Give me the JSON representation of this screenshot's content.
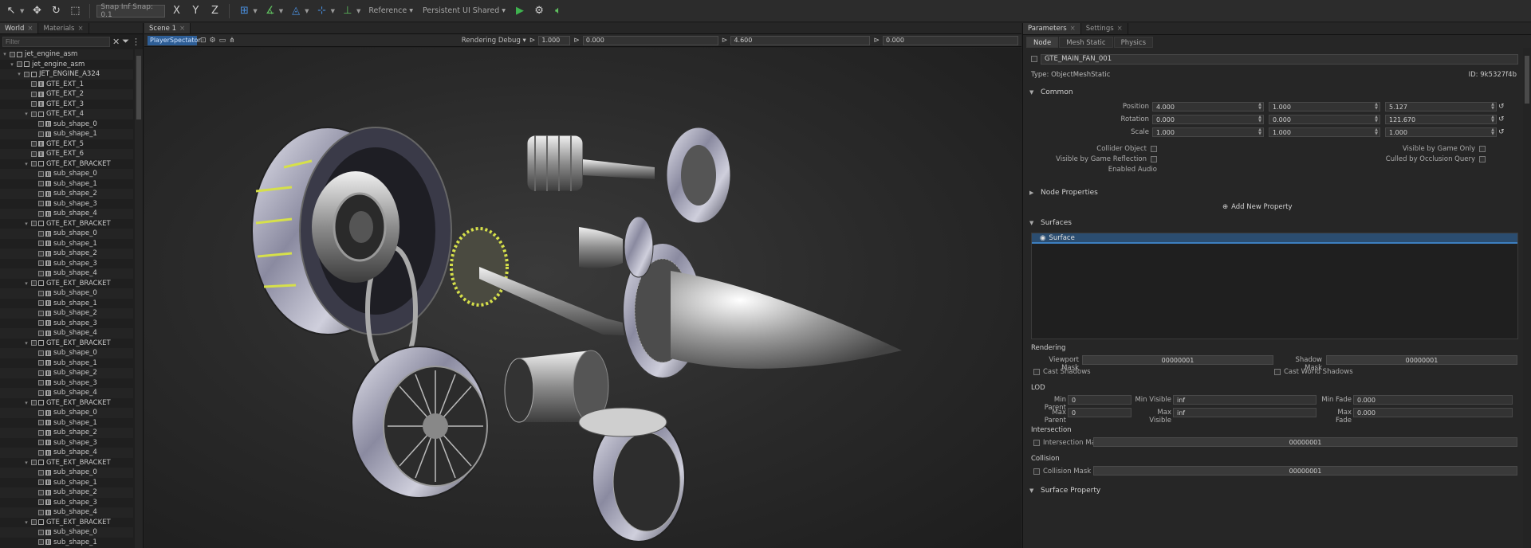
{
  "toolbar": {
    "snap_value": "Snap Inf  Snap: 0.1",
    "reference_label": "Reference ▾",
    "snapping_label": "Persistent UI Shared ▾"
  },
  "world": {
    "tabs": [
      {
        "label": "World"
      },
      {
        "label": "Materials"
      }
    ],
    "search_placeholder": "Filter",
    "tree": [
      {
        "label": "jet_engine_asm",
        "level": 0,
        "exp": "▾",
        "icon": "node"
      },
      {
        "label": "jet_engine_asm",
        "level": 1,
        "exp": "▾",
        "icon": "node"
      },
      {
        "label": "JET_ENGINE_A324",
        "level": 2,
        "exp": "▾",
        "icon": "node"
      },
      {
        "label": "GTE_EXT_1",
        "level": 3,
        "exp": "",
        "icon": "mesh"
      },
      {
        "label": "GTE_EXT_2",
        "level": 3,
        "exp": "",
        "icon": "mesh"
      },
      {
        "label": "GTE_EXT_3",
        "level": 3,
        "exp": "",
        "icon": "mesh"
      },
      {
        "label": "GTE_EXT_4",
        "level": 3,
        "exp": "▾",
        "icon": "node"
      },
      {
        "label": "sub_shape_0",
        "level": 4,
        "exp": "",
        "icon": "mesh"
      },
      {
        "label": "sub_shape_1",
        "level": 4,
        "exp": "",
        "icon": "mesh"
      },
      {
        "label": "GTE_EXT_5",
        "level": 3,
        "exp": "",
        "icon": "mesh"
      },
      {
        "label": "GTE_EXT_6",
        "level": 3,
        "exp": "",
        "icon": "mesh"
      },
      {
        "label": "GTE_EXT_BRACKET",
        "level": 3,
        "exp": "▾",
        "icon": "node"
      },
      {
        "label": "sub_shape_0",
        "level": 4,
        "exp": "",
        "icon": "mesh"
      },
      {
        "label": "sub_shape_1",
        "level": 4,
        "exp": "",
        "icon": "mesh"
      },
      {
        "label": "sub_shape_2",
        "level": 4,
        "exp": "",
        "icon": "mesh"
      },
      {
        "label": "sub_shape_3",
        "level": 4,
        "exp": "",
        "icon": "mesh"
      },
      {
        "label": "sub_shape_4",
        "level": 4,
        "exp": "",
        "icon": "mesh"
      },
      {
        "label": "GTE_EXT_BRACKET",
        "level": 3,
        "exp": "▾",
        "icon": "node"
      },
      {
        "label": "sub_shape_0",
        "level": 4,
        "exp": "",
        "icon": "mesh"
      },
      {
        "label": "sub_shape_1",
        "level": 4,
        "exp": "",
        "icon": "mesh"
      },
      {
        "label": "sub_shape_2",
        "level": 4,
        "exp": "",
        "icon": "mesh"
      },
      {
        "label": "sub_shape_3",
        "level": 4,
        "exp": "",
        "icon": "mesh"
      },
      {
        "label": "sub_shape_4",
        "level": 4,
        "exp": "",
        "icon": "mesh"
      },
      {
        "label": "GTE_EXT_BRACKET",
        "level": 3,
        "exp": "▾",
        "icon": "node"
      },
      {
        "label": "sub_shape_0",
        "level": 4,
        "exp": "",
        "icon": "mesh"
      },
      {
        "label": "sub_shape_1",
        "level": 4,
        "exp": "",
        "icon": "mesh"
      },
      {
        "label": "sub_shape_2",
        "level": 4,
        "exp": "",
        "icon": "mesh"
      },
      {
        "label": "sub_shape_3",
        "level": 4,
        "exp": "",
        "icon": "mesh"
      },
      {
        "label": "sub_shape_4",
        "level": 4,
        "exp": "",
        "icon": "mesh"
      },
      {
        "label": "GTE_EXT_BRACKET",
        "level": 3,
        "exp": "▾",
        "icon": "node"
      },
      {
        "label": "sub_shape_0",
        "level": 4,
        "exp": "",
        "icon": "mesh"
      },
      {
        "label": "sub_shape_1",
        "level": 4,
        "exp": "",
        "icon": "mesh"
      },
      {
        "label": "sub_shape_2",
        "level": 4,
        "exp": "",
        "icon": "mesh"
      },
      {
        "label": "sub_shape_3",
        "level": 4,
        "exp": "",
        "icon": "mesh"
      },
      {
        "label": "sub_shape_4",
        "level": 4,
        "exp": "",
        "icon": "mesh"
      },
      {
        "label": "GTE_EXT_BRACKET",
        "level": 3,
        "exp": "▾",
        "icon": "node"
      },
      {
        "label": "sub_shape_0",
        "level": 4,
        "exp": "",
        "icon": "mesh"
      },
      {
        "label": "sub_shape_1",
        "level": 4,
        "exp": "",
        "icon": "mesh"
      },
      {
        "label": "sub_shape_2",
        "level": 4,
        "exp": "",
        "icon": "mesh"
      },
      {
        "label": "sub_shape_3",
        "level": 4,
        "exp": "",
        "icon": "mesh"
      },
      {
        "label": "sub_shape_4",
        "level": 4,
        "exp": "",
        "icon": "mesh"
      },
      {
        "label": "GTE_EXT_BRACKET",
        "level": 3,
        "exp": "▾",
        "icon": "node"
      },
      {
        "label": "sub_shape_0",
        "level": 4,
        "exp": "",
        "icon": "mesh"
      },
      {
        "label": "sub_shape_1",
        "level": 4,
        "exp": "",
        "icon": "mesh"
      },
      {
        "label": "sub_shape_2",
        "level": 4,
        "exp": "",
        "icon": "mesh"
      },
      {
        "label": "sub_shape_3",
        "level": 4,
        "exp": "",
        "icon": "mesh"
      },
      {
        "label": "sub_shape_4",
        "level": 4,
        "exp": "",
        "icon": "mesh"
      },
      {
        "label": "GTE_EXT_BRACKET",
        "level": 3,
        "exp": "▾",
        "icon": "node"
      },
      {
        "label": "sub_shape_0",
        "level": 4,
        "exp": "",
        "icon": "mesh"
      },
      {
        "label": "sub_shape_1",
        "level": 4,
        "exp": "",
        "icon": "mesh"
      }
    ]
  },
  "viewport": {
    "tab": "Scene 1",
    "camera": "PlayerSpectator",
    "render_mode": "Rendering Debug ▾",
    "fields": [
      "1.000",
      "0.000",
      "4.600",
      "0.000"
    ]
  },
  "params": {
    "tabs": [
      {
        "label": "Parameters"
      },
      {
        "label": "Settings"
      }
    ],
    "subtabs": [
      "Node",
      "Mesh Static",
      "Physics"
    ],
    "node_name": "GTE_MAIN_FAN_001",
    "type_label": "Type: ObjectMeshStatic",
    "id_label": "ID: 9k5327f4b",
    "common": {
      "title": "Common",
      "position_label": "Position",
      "position": [
        "4.000",
        "1.000",
        "5.127"
      ],
      "rotation_label": "Rotation",
      "rotation": [
        "0.000",
        "0.000",
        "121.670"
      ],
      "scale_label": "Scale",
      "scale": [
        "1.000",
        "1.000",
        "1.000"
      ],
      "collider_label": "Collider Object",
      "intersection_label": "Visible by Game Only",
      "trigger_label": "Visible by Game Reflection",
      "culled_label": "Culled by Occlusion Query",
      "handled_label": "Enabled Audio"
    },
    "node_properties": {
      "title": "Node Properties",
      "add_label": "Add New Property"
    },
    "surfaces": {
      "title": "Surfaces",
      "items": [
        "Surface"
      ]
    },
    "rendering": {
      "title": "Rendering",
      "viewport_mask_label": "Viewport Mask",
      "viewport_mask": "00000001",
      "shadow_mask_label": "Shadow Mask",
      "shadow_mask": "00000001",
      "cast_shadow": "Cast Shadows",
      "cast_world_shadow": "Cast World Shadows"
    },
    "lod": {
      "title": "LOD",
      "min_parent_label": "Min Parent",
      "min_parent": "0",
      "min_visible_label": "Min Visible",
      "min_visible": "inf",
      "min_fade_label": "Min Fade",
      "min_fade": "0.000",
      "max_parent_label": "Max Parent",
      "max_parent": "0",
      "max_visible_label": "Max Visible",
      "max_visible": "inf",
      "max_fade_label": "Max Fade",
      "max_fade": "0.000"
    },
    "intersection": {
      "title": "Intersection",
      "mask_label": "Intersection Mask",
      "mask": "00000001"
    },
    "collision": {
      "title": "Collision",
      "mask_label": "Collision Mask",
      "mask": "00000001"
    },
    "surface_property": {
      "title": "Surface Property"
    }
  },
  "colors": {
    "accent": "#3d7fc0",
    "selection_yellow": "#d6e04a",
    "play": "#3fb34f"
  }
}
